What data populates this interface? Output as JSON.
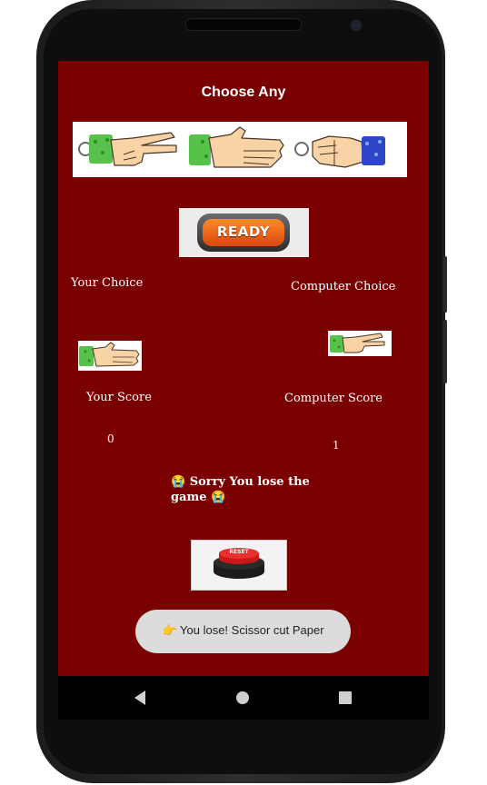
{
  "game": {
    "title": "Choose Any",
    "options": [
      {
        "name": "scissor",
        "selected": false
      },
      {
        "name": "paper",
        "selected": true
      },
      {
        "name": "rock",
        "selected": false
      }
    ],
    "ready_label": "READY",
    "your_choice_label": "Your Choice",
    "computer_choice_label": "Computer Choice",
    "your_choice": "paper",
    "computer_choice": "scissor",
    "your_score_label": "Your Score",
    "computer_score_label": "Computer Score",
    "your_score": "0",
    "computer_score": "1",
    "result_text": "😭 Sorry You lose the game 😭",
    "reset_label": "RESET"
  },
  "toast": {
    "text": "👉 You lose! Scissor cut Paper"
  },
  "navbar": {
    "back": "back-icon",
    "home": "home-icon",
    "recents": "recents-icon"
  },
  "colors": {
    "background": "#7a0000",
    "sleeve_green": "#57c24a",
    "sleeve_blue": "#2f46c9",
    "skin": "#f8d3a6",
    "ready_orange": "#e85a12"
  }
}
